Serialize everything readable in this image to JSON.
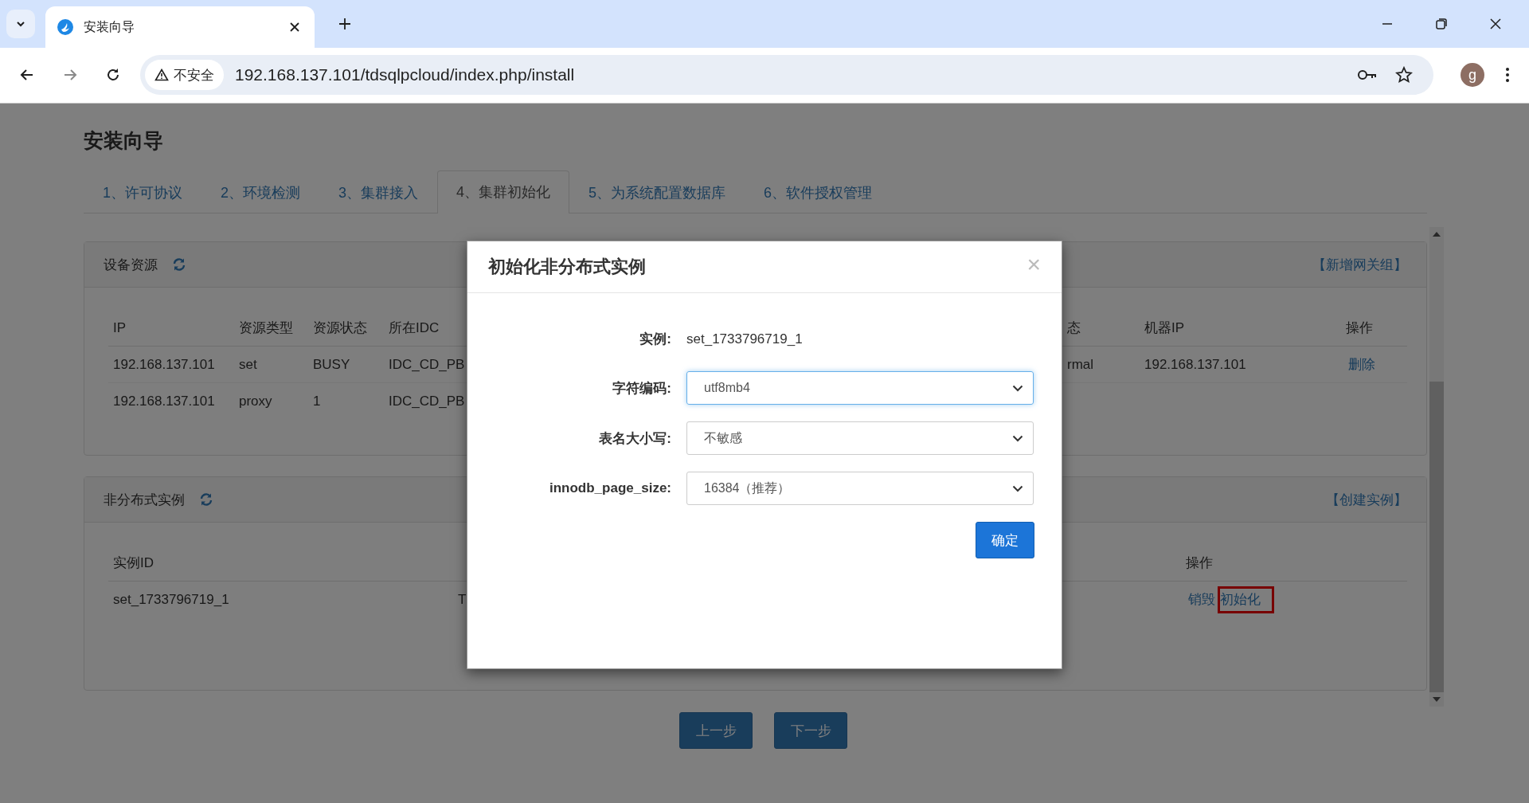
{
  "browser": {
    "tab_title": "安装向导",
    "security_label": "不安全",
    "url": "192.168.137.101/tdsqlpcloud/index.php/install",
    "avatar_letter": "g"
  },
  "page": {
    "title": "安装向导",
    "steps": [
      {
        "label": "1、许可协议",
        "selected": false
      },
      {
        "label": "2、环境检测",
        "selected": false
      },
      {
        "label": "3、集群接入",
        "selected": false
      },
      {
        "label": "4、集群初始化",
        "selected": true
      },
      {
        "label": "5、为系统配置数据库",
        "selected": false
      },
      {
        "label": "6、软件授权管理",
        "selected": false
      }
    ],
    "panels": [
      {
        "title": "设备资源",
        "action": "【新增网关组】",
        "columns": [
          "IP",
          "资源类型",
          "资源状态",
          "所在IDC",
          "态",
          "机器IP",
          "操作"
        ],
        "rows": [
          {
            "cells": [
              "192.168.137.101",
              "set",
              "BUSY",
              "IDC_CD_PB",
              "rmal",
              "192.168.137.101"
            ],
            "actions": [
              {
                "label": "删除",
                "highlighted": false
              }
            ]
          },
          {
            "cells": [
              "192.168.137.101",
              "proxy",
              "1",
              "IDC_CD_PB"
            ],
            "actions": []
          }
        ]
      },
      {
        "title": "非分布式实例",
        "action": "【创建实例】",
        "columns": [
          "实例ID",
          "操作"
        ],
        "rows": [
          {
            "cells": [
              "set_1733796719_1",
              "T"
            ],
            "actions": [
              {
                "label": "销毁",
                "highlighted": false
              },
              {
                "label": "初始化",
                "highlighted": true
              }
            ]
          }
        ]
      }
    ],
    "buttons": [
      "上一步",
      "下一步"
    ]
  },
  "modal": {
    "title": "初始化非分布式实例",
    "close": "×",
    "fields": [
      {
        "kind": "text",
        "label": "实例:",
        "value": "set_1733796719_1"
      },
      {
        "kind": "select",
        "label": "字符编码:",
        "value": "utf8mb4",
        "focused": true
      },
      {
        "kind": "select",
        "label": "表名大小写:",
        "value": "不敏感",
        "focused": false
      },
      {
        "kind": "select",
        "label": "innodb_page_size:",
        "value": "16384（推荐）",
        "focused": false
      }
    ],
    "confirm": "确定"
  }
}
